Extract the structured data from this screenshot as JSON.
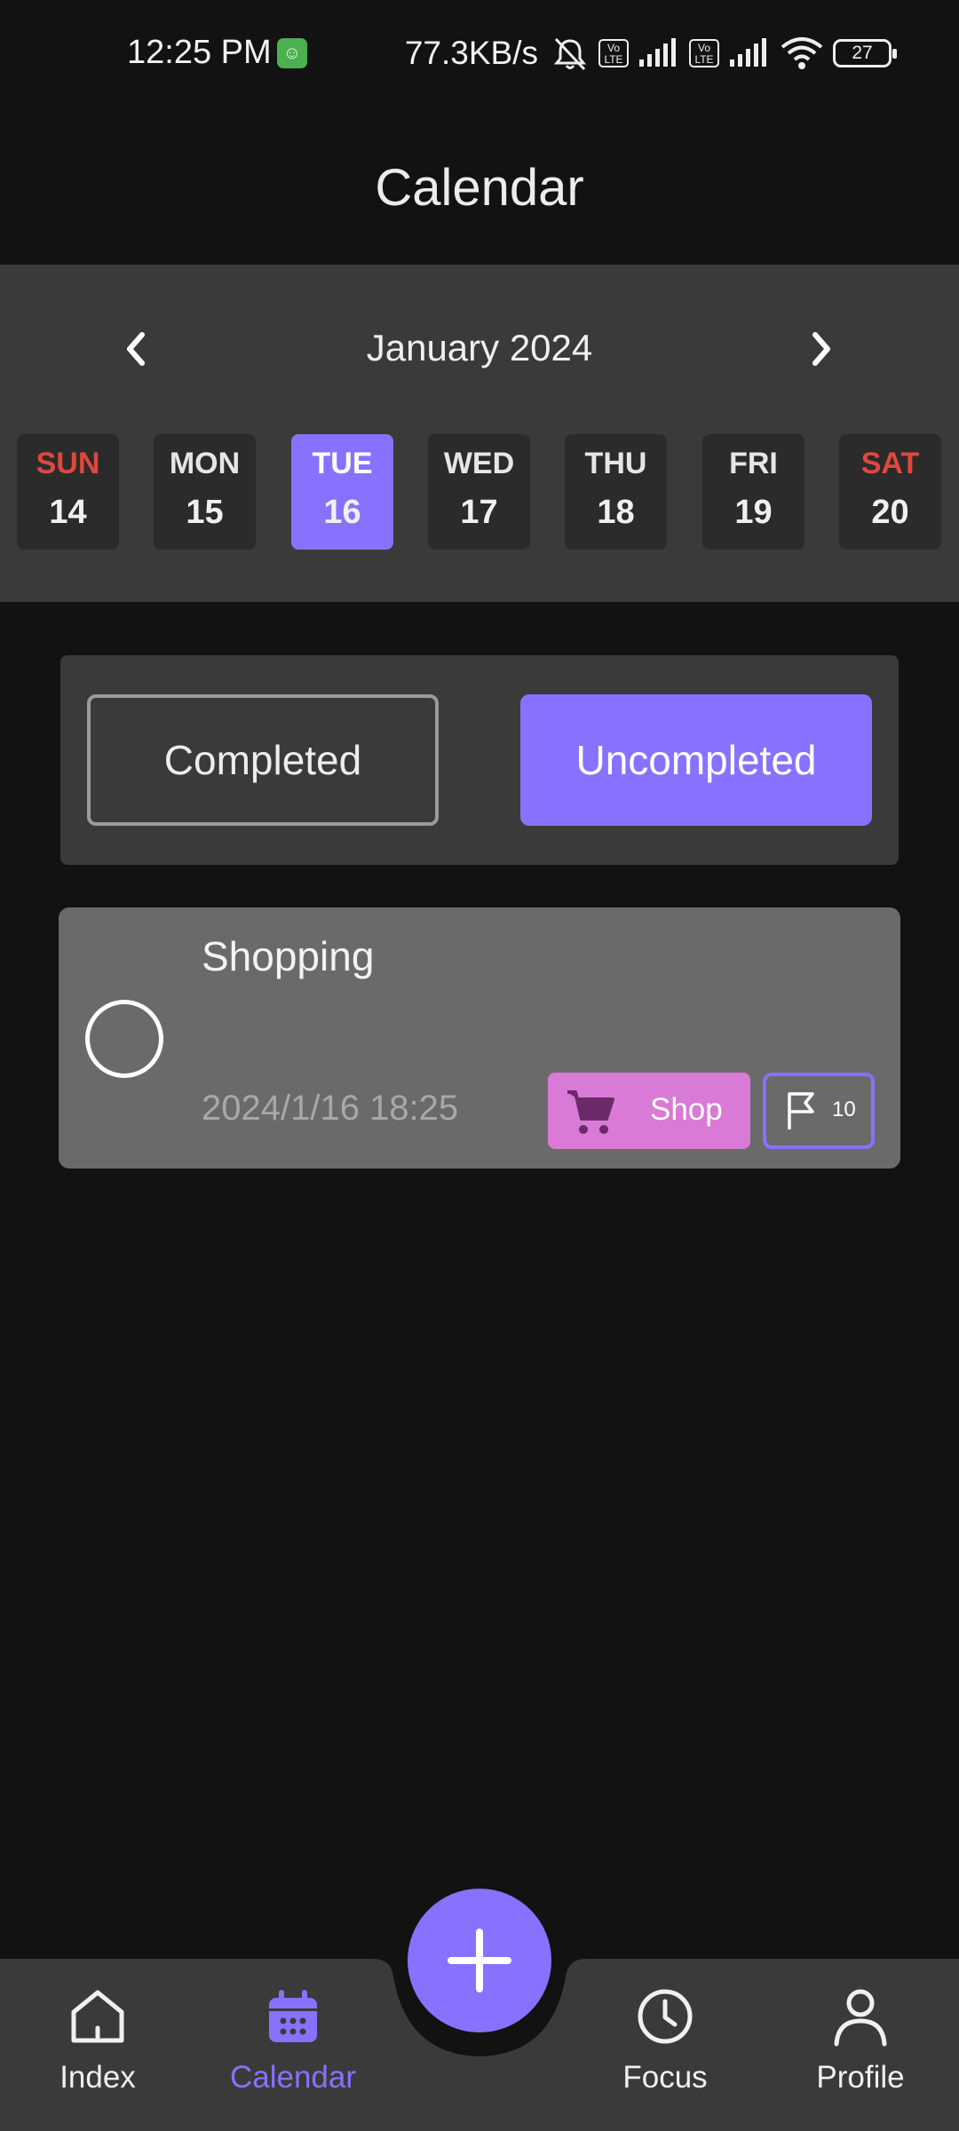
{
  "status_bar": {
    "time": "12:25 PM",
    "network_speed": "77.3KB/s",
    "lte_label": "Vo LTE",
    "battery": "27"
  },
  "header": {
    "title": "Calendar"
  },
  "calendar": {
    "month_label": "January 2024",
    "days": [
      {
        "name": "SUN",
        "num": "14",
        "weekend": true,
        "selected": false
      },
      {
        "name": "MON",
        "num": "15",
        "weekend": false,
        "selected": false
      },
      {
        "name": "TUE",
        "num": "16",
        "weekend": false,
        "selected": true
      },
      {
        "name": "WED",
        "num": "17",
        "weekend": false,
        "selected": false
      },
      {
        "name": "THU",
        "num": "18",
        "weekend": false,
        "selected": false
      },
      {
        "name": "FRI",
        "num": "19",
        "weekend": false,
        "selected": false
      },
      {
        "name": "SAT",
        "num": "20",
        "weekend": true,
        "selected": false
      }
    ]
  },
  "filter": {
    "completed_label": "Completed",
    "uncompleted_label": "Uncompleted",
    "active": "uncompleted"
  },
  "tasks": [
    {
      "title": "Shopping",
      "datetime": "2024/1/16 18:25",
      "tag_label": "Shop",
      "tag_icon": "cart-icon",
      "priority": "10",
      "completed": false
    }
  ],
  "bottom_nav": {
    "items": [
      {
        "label": "Index",
        "icon": "home-icon",
        "active": false
      },
      {
        "label": "Calendar",
        "icon": "calendar-icon",
        "active": true
      },
      {
        "label": "Focus",
        "icon": "clock-icon",
        "active": false
      },
      {
        "label": "Profile",
        "icon": "person-icon",
        "active": false
      }
    ],
    "fab_icon": "plus-icon"
  },
  "colors": {
    "accent": "#8672ff",
    "weekend": "#e0473e",
    "tag_shop": "#d97ad6",
    "background": "#121212",
    "panel": "#3a3a3a",
    "card": "#6a6a6a"
  }
}
